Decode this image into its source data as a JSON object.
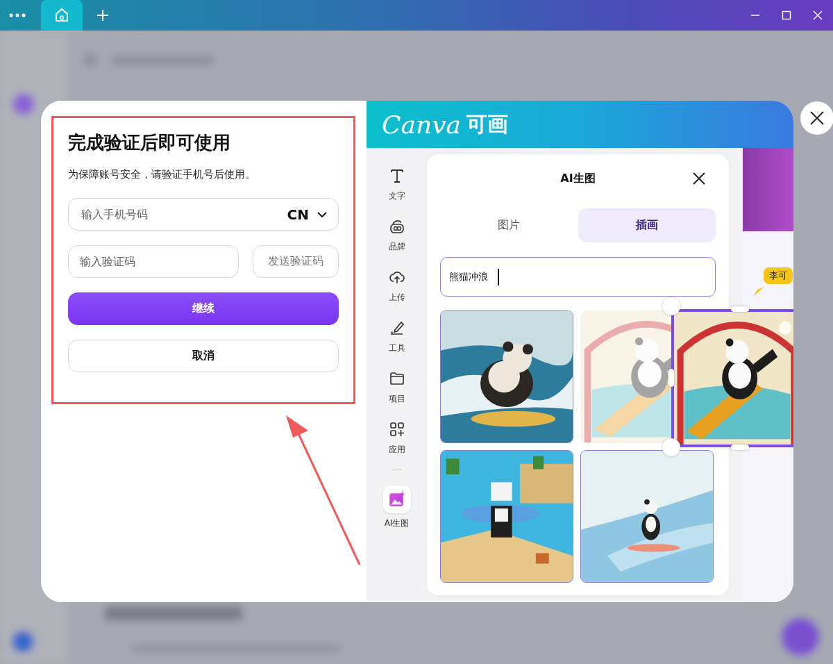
{
  "verification": {
    "title": "完成验证后即可使用",
    "subtitle": "为保障账号安全，请验证手机号后使用。",
    "phone": {
      "placeholder": "输入手机号码",
      "country": "CN"
    },
    "code": {
      "placeholder": "输入验证码"
    },
    "send_code": "发送验证码",
    "continue": "继续",
    "cancel": "取消"
  },
  "editor": {
    "logo": "Canva",
    "logo_cn": "可画",
    "tools": [
      {
        "label": "文字",
        "kind": "text",
        "selected": false
      },
      {
        "label": "品牌",
        "kind": "brand",
        "selected": false
      },
      {
        "label": "上传",
        "kind": "upload",
        "selected": false
      },
      {
        "label": "工具",
        "kind": "draw",
        "selected": false
      },
      {
        "label": "项目",
        "kind": "folder",
        "selected": false
      },
      {
        "label": "应用",
        "kind": "apps",
        "selected": false
      },
      {
        "label": "AI生图",
        "kind": "ai",
        "selected": true
      }
    ],
    "panel": {
      "title": "AI生图",
      "tabs": [
        {
          "label": "图片",
          "selected": false
        },
        {
          "label": "插画",
          "selected": true
        }
      ],
      "prompt": "熊猫冲浪",
      "results": [
        {
          "kind": "picture",
          "dragging": false
        },
        {
          "kind": "picture",
          "dragging": true
        },
        {
          "kind": "picture",
          "dragging": false
        },
        {
          "kind": "picture",
          "dragging": false
        }
      ]
    },
    "collaborator": {
      "name": "李可"
    }
  }
}
